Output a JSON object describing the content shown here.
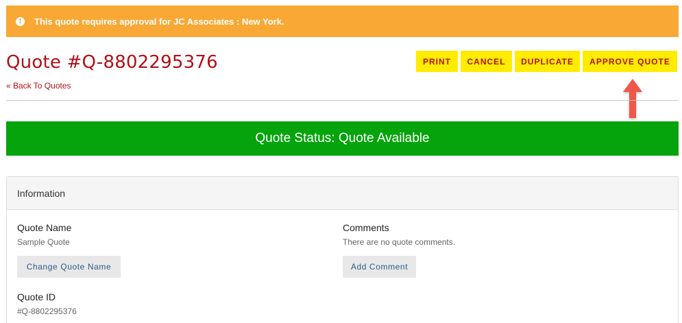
{
  "alert": {
    "icon": "exclamation-icon",
    "icon_glyph": "!",
    "text": "This quote requires approval for JC Associates : New York."
  },
  "header": {
    "title": "Quote #Q-8802295376",
    "back_link": "« Back To Quotes"
  },
  "actions": {
    "print": "PRINT",
    "cancel": "CANCEL",
    "duplicate": "DUPLICATE",
    "approve": "APPROVE QUOTE"
  },
  "status": {
    "text": "Quote Status: Quote Available"
  },
  "information": {
    "heading": "Information",
    "quote_name_label": "Quote Name",
    "quote_name_value": "Sample Quote",
    "change_name_button": "Change Quote Name",
    "comments_label": "Comments",
    "comments_value": "There are no quote comments.",
    "add_comment_button": "Add Comment",
    "quote_id_label": "Quote ID",
    "quote_id_value": "#Q-8802295376"
  },
  "colors": {
    "alert_bg": "#f9a835",
    "title_red": "#b01016",
    "button_yellow": "#ffec00",
    "status_green": "#05a30c",
    "annotation_arrow": "#f0574a"
  }
}
